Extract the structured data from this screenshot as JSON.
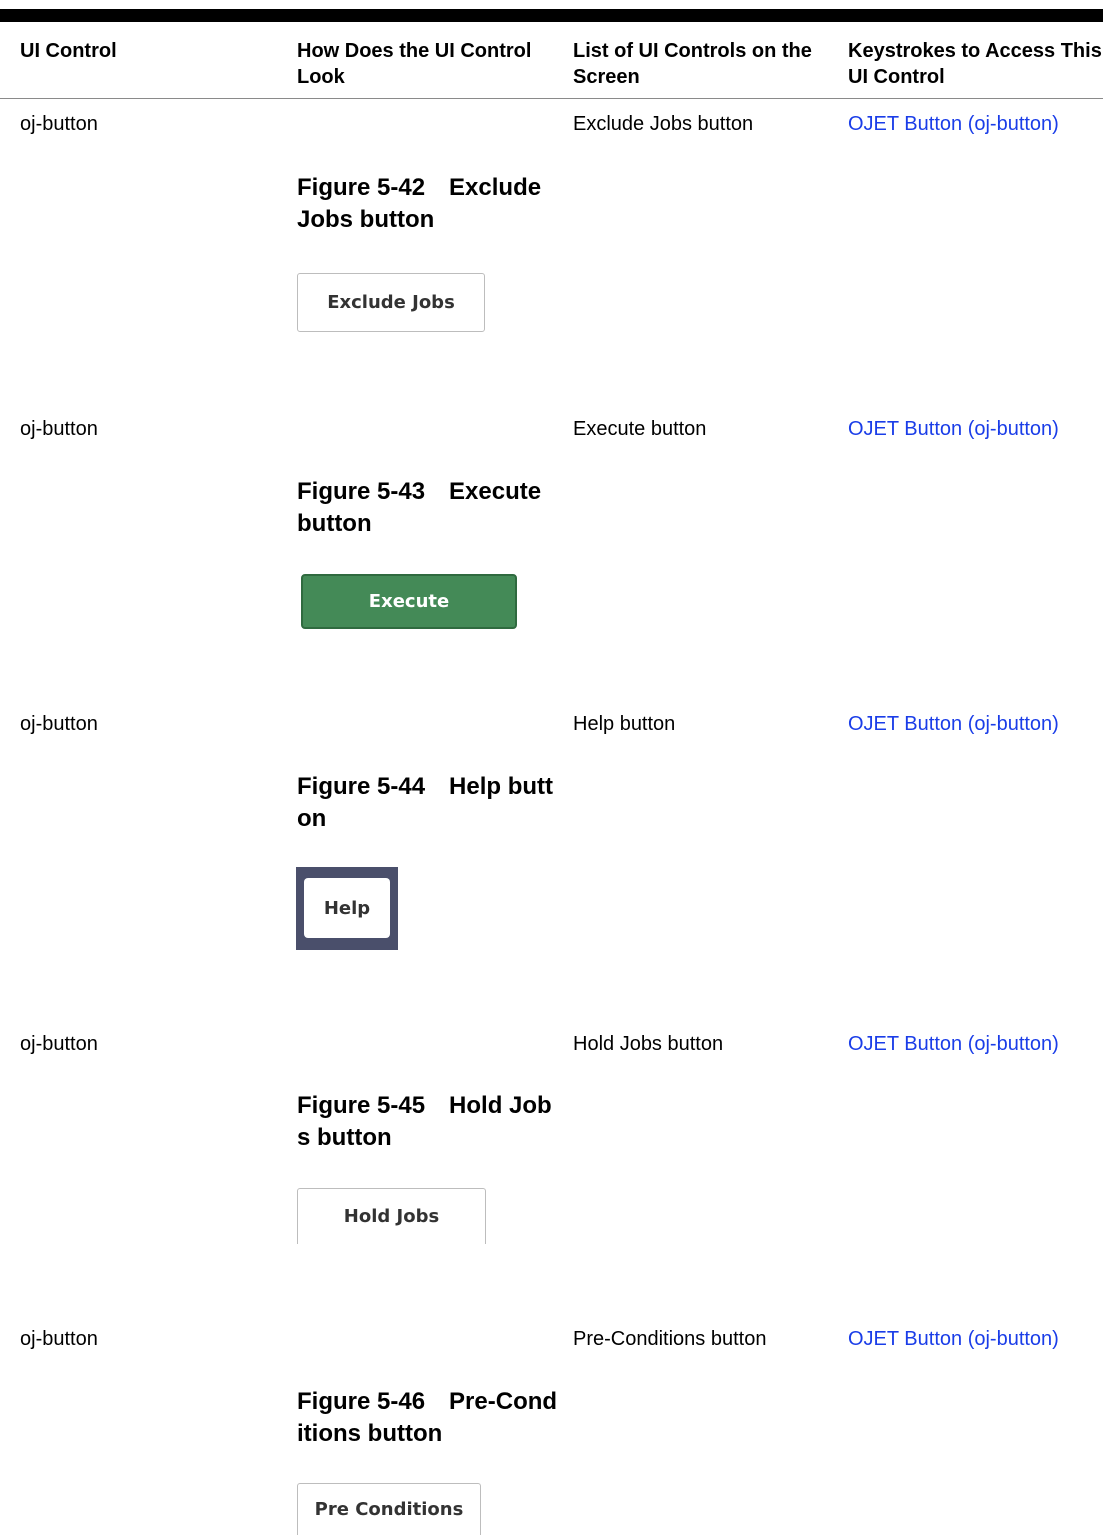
{
  "table": {
    "headers": [
      "UI Control",
      "How Does the UI Control Look",
      "List of UI Controls on the Screen",
      "Keystrokes to Access This UI Control"
    ],
    "rows": [
      {
        "control": "oj-button",
        "figure_number": "Figure 5-42",
        "figure_title": "Exclude Jobs button",
        "button_text": "Exclude Jobs",
        "list_item": "Exclude Jobs button",
        "keystroke_link": "OJET Button (oj-button)"
      },
      {
        "control": "oj-button",
        "figure_number": "Figure 5-43",
        "figure_title": "Execute button",
        "button_text": "Execute",
        "list_item": "Execute button",
        "keystroke_link": "OJET Button (oj-button)"
      },
      {
        "control": "oj-button",
        "figure_number": "Figure 5-44",
        "figure_title": "Help button",
        "button_text": "Help",
        "list_item": "Help button",
        "keystroke_link": "OJET Button (oj-button)"
      },
      {
        "control": "oj-button",
        "figure_number": "Figure 5-45",
        "figure_title": "Hold Jobs button",
        "button_text": "Hold Jobs",
        "list_item": "Hold Jobs button",
        "keystroke_link": "OJET Button (oj-button)"
      },
      {
        "control": "oj-button",
        "figure_number": "Figure 5-46",
        "figure_title": "Pre-Conditions button",
        "button_text": "Pre Conditions",
        "list_item": "Pre-Conditions button",
        "keystroke_link": "OJET Button (oj-button)"
      }
    ]
  },
  "colors": {
    "link": "#1a3de8",
    "execute_button": "#448a57",
    "help_frame": "#4a4f6b"
  }
}
